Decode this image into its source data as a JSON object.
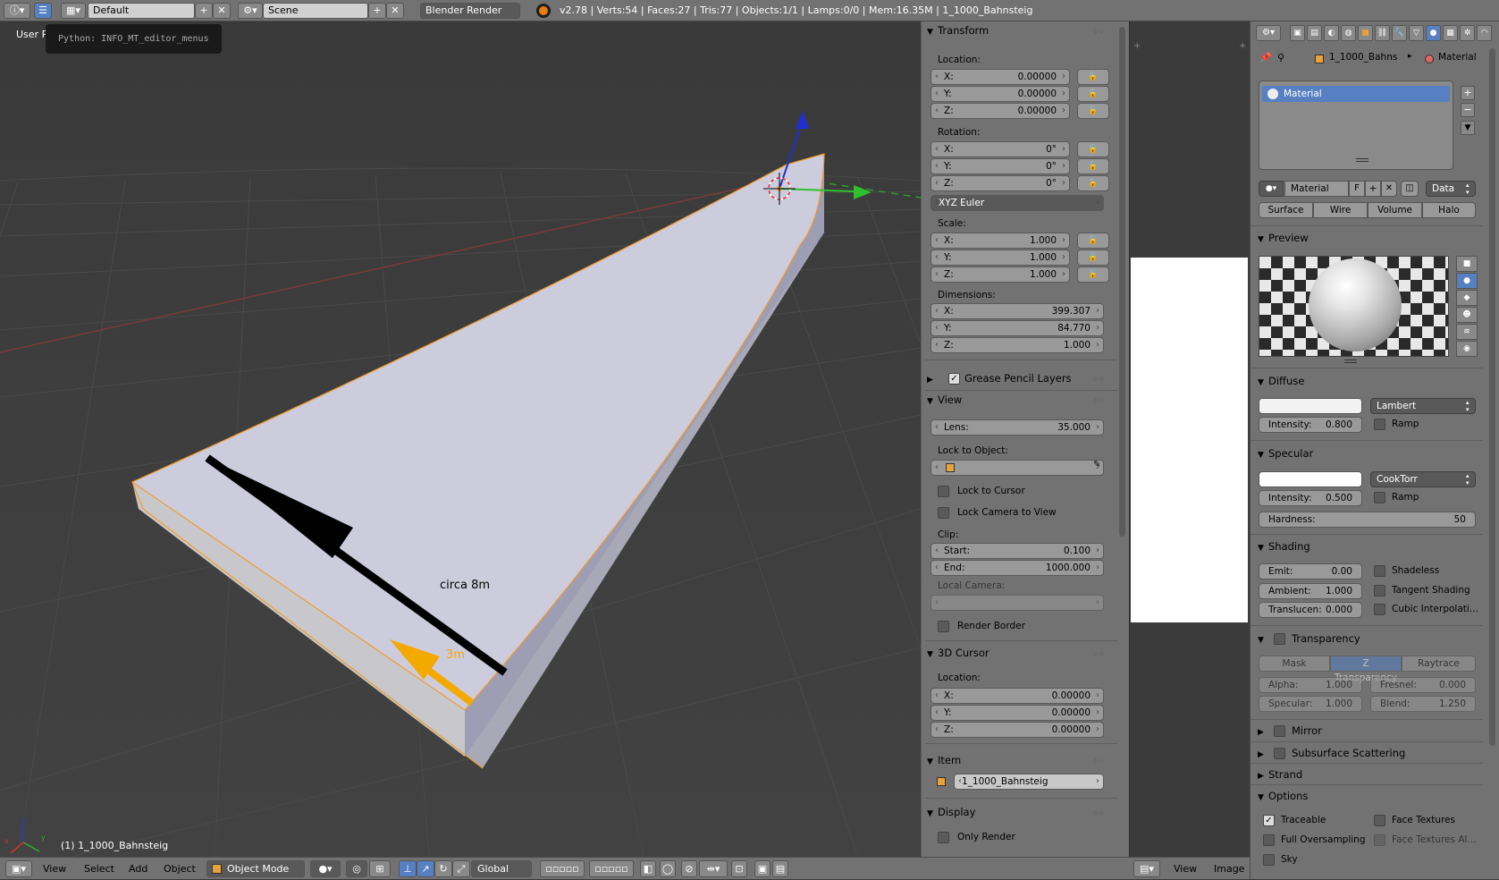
{
  "topbar": {
    "layout_name": "Default",
    "scene_name": "Scene",
    "render_engine": "Blender Render",
    "stats": "v2.78 | Verts:54 | Faces:27 | Tris:77 | Objects:1/1 | Lamps:0/0 | Mem:16.35M | 1_1000_Bahnsteig"
  },
  "viewport": {
    "view_label": "User Pe",
    "tooltip": "Python: INFO_MT_editor_menus",
    "annotation_8m": "circa 8m",
    "annotation_3m": "3m",
    "object_label": "(1) 1_1000_Bahnsteig",
    "axis_x": "x",
    "axis_y": "y",
    "axis_z": "z"
  },
  "bottombar": {
    "menu_view": "View",
    "menu_select": "Select",
    "menu_add": "Add",
    "menu_object": "Object",
    "mode": "Object Mode",
    "orientation": "Global"
  },
  "npanel": {
    "transform": {
      "title": "Transform",
      "location_label": "Location:",
      "location": [
        {
          "k": "X:",
          "v": "0.00000"
        },
        {
          "k": "Y:",
          "v": "0.00000"
        },
        {
          "k": "Z:",
          "v": "0.00000"
        }
      ],
      "rotation_label": "Rotation:",
      "rotation": [
        {
          "k": "X:",
          "v": "0°"
        },
        {
          "k": "Y:",
          "v": "0°"
        },
        {
          "k": "Z:",
          "v": "0°"
        }
      ],
      "rotation_mode": "XYZ Euler",
      "scale_label": "Scale:",
      "scale": [
        {
          "k": "X:",
          "v": "1.000"
        },
        {
          "k": "Y:",
          "v": "1.000"
        },
        {
          "k": "Z:",
          "v": "1.000"
        }
      ],
      "dimensions_label": "Dimensions:",
      "dimensions": [
        {
          "k": "X:",
          "v": "399.307"
        },
        {
          "k": "Y:",
          "v": "84.770"
        },
        {
          "k": "Z:",
          "v": "1.000"
        }
      ]
    },
    "grease_pencil": {
      "title": "Grease Pencil Layers",
      "enabled": true
    },
    "view": {
      "title": "View",
      "lens_label": "Lens:",
      "lens_value": "35.000",
      "lock_to_object_label": "Lock to Object:",
      "lock_to_cursor": "Lock to Cursor",
      "lock_camera": "Lock Camera to View",
      "clip_label": "Clip:",
      "clip_start_label": "Start:",
      "clip_start": "0.100",
      "clip_end_label": "End:",
      "clip_end": "1000.000",
      "local_camera_label": "Local Camera:",
      "render_border": "Render Border"
    },
    "cursor": {
      "title": "3D Cursor",
      "location_label": "Location:",
      "location": [
        {
          "k": "X:",
          "v": "0.00000"
        },
        {
          "k": "Y:",
          "v": "0.00000"
        },
        {
          "k": "Z:",
          "v": "0.00000"
        }
      ]
    },
    "item": {
      "title": "Item",
      "name": "1_1000_Bahnsteig"
    },
    "display": {
      "title": "Display",
      "only_render": "Only Render"
    }
  },
  "image_editor": {
    "menu_view": "View",
    "menu_image": "Image"
  },
  "properties": {
    "breadcrumb_object": "1_1000_Bahns",
    "breadcrumb_material": "Material",
    "slot_name": "Material",
    "material_name": "Material",
    "fake_user": "F",
    "link_mode": "Data",
    "tabs": [
      "Surface",
      "Wire",
      "Volume",
      "Halo"
    ],
    "active_tab": "Surface",
    "preview_title": "Preview",
    "diffuse": {
      "title": "Diffuse",
      "shader": "Lambert",
      "intensity_label": "Intensity:",
      "intensity": "0.800",
      "ramp": "Ramp",
      "color": "#f2f2f2"
    },
    "specular": {
      "title": "Specular",
      "shader": "CookTorr",
      "intensity_label": "Intensity:",
      "intensity": "0.500",
      "ramp": "Ramp",
      "hardness_label": "Hardness:",
      "hardness": "50",
      "color": "#ffffff"
    },
    "shading": {
      "title": "Shading",
      "emit_label": "Emit:",
      "emit": "0.00",
      "ambient_label": "Ambient:",
      "ambient": "1.000",
      "translucency_label": "Translucen:",
      "translucency": "0.000",
      "shadeless": "Shadeless",
      "tangent": "Tangent Shading",
      "cubic": "Cubic Interpolati..."
    },
    "transparency": {
      "title": "Transparency",
      "modes": [
        "Mask",
        "Z Transparency",
        "Raytrace"
      ],
      "active_mode": "Z Transparency",
      "alpha_label": "Alpha:",
      "alpha": "1.000",
      "fresnel_label": "Fresnel:",
      "fresnel": "0.000",
      "specular_label": "Specular:",
      "specular": "1.000",
      "blend_label": "Blend:",
      "blend": "1.250"
    },
    "mirror": "Mirror",
    "sss": "Subsurface Scattering",
    "strand": "Strand",
    "options": {
      "title": "Options",
      "traceable": "Traceable",
      "face_textures": "Face Textures",
      "full_oversampling": "Full Oversampling",
      "face_textures_alpha": "Face Textures Al...",
      "sky": "Sky"
    }
  },
  "colors": {
    "accent": "#5680c2",
    "panel_bg": "#727272",
    "viewport_bg": "#3e3e3e",
    "selection_outline": "#f29c2c",
    "arrow_orange": "#f4a900"
  }
}
